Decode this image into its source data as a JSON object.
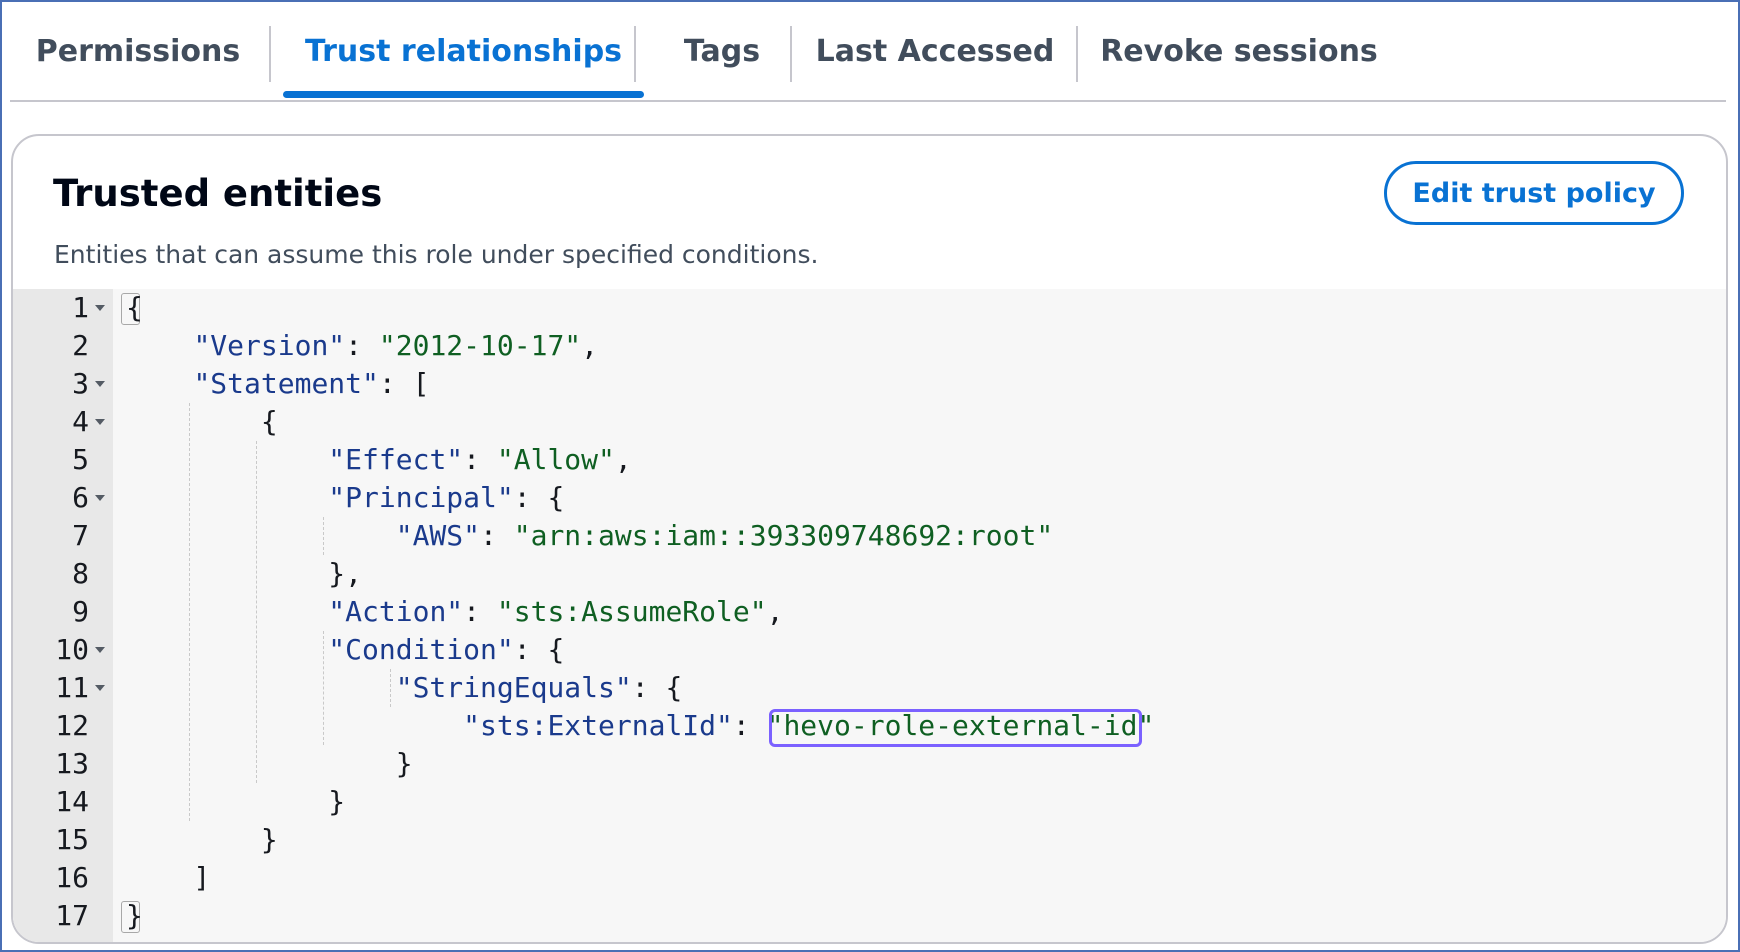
{
  "tabs": [
    {
      "label": "Permissions",
      "active": false
    },
    {
      "label": "Trust relationships",
      "active": true
    },
    {
      "label": "Tags",
      "active": false
    },
    {
      "label": "Last Accessed",
      "active": false
    },
    {
      "label": "Revoke sessions",
      "active": false
    }
  ],
  "panel": {
    "title": "Trusted entities",
    "description": "Entities that can assume this role under specified conditions.",
    "edit_button": "Edit trust policy"
  },
  "editor": {
    "lines": [
      {
        "n": "1",
        "fold": true,
        "t": [
          [
            "p",
            "{"
          ]
        ]
      },
      {
        "n": "2",
        "fold": false,
        "t": [
          [
            "p",
            "    "
          ],
          [
            "k",
            "\"Version\""
          ],
          [
            "p",
            ": "
          ],
          [
            "s",
            "\"2012-10-17\""
          ],
          [
            "p",
            ","
          ]
        ]
      },
      {
        "n": "3",
        "fold": true,
        "t": [
          [
            "p",
            "    "
          ],
          [
            "k",
            "\"Statement\""
          ],
          [
            "p",
            ": ["
          ]
        ]
      },
      {
        "n": "4",
        "fold": true,
        "t": [
          [
            "p",
            "        {"
          ]
        ]
      },
      {
        "n": "5",
        "fold": false,
        "t": [
          [
            "p",
            "            "
          ],
          [
            "k",
            "\"Effect\""
          ],
          [
            "p",
            ": "
          ],
          [
            "s",
            "\"Allow\""
          ],
          [
            "p",
            ","
          ]
        ]
      },
      {
        "n": "6",
        "fold": true,
        "t": [
          [
            "p",
            "            "
          ],
          [
            "k",
            "\"Principal\""
          ],
          [
            "p",
            ": {"
          ]
        ]
      },
      {
        "n": "7",
        "fold": false,
        "t": [
          [
            "p",
            "                "
          ],
          [
            "k",
            "\"AWS\""
          ],
          [
            "p",
            ": "
          ],
          [
            "s",
            "\"arn:aws:iam::393309748692:root\""
          ]
        ]
      },
      {
        "n": "8",
        "fold": false,
        "t": [
          [
            "p",
            "            },"
          ]
        ]
      },
      {
        "n": "9",
        "fold": false,
        "t": [
          [
            "p",
            "            "
          ],
          [
            "k",
            "\"Action\""
          ],
          [
            "p",
            ": "
          ],
          [
            "s",
            "\"sts:AssumeRole\""
          ],
          [
            "p",
            ","
          ]
        ]
      },
      {
        "n": "10",
        "fold": true,
        "t": [
          [
            "p",
            "            "
          ],
          [
            "k",
            "\"Condition\""
          ],
          [
            "p",
            ": {"
          ]
        ]
      },
      {
        "n": "11",
        "fold": true,
        "t": [
          [
            "p",
            "                "
          ],
          [
            "k",
            "\"StringEquals\""
          ],
          [
            "p",
            ": {"
          ]
        ]
      },
      {
        "n": "12",
        "fold": false,
        "t": [
          [
            "p",
            "                    "
          ],
          [
            "k",
            "\"sts:ExternalId\""
          ],
          [
            "p",
            ": "
          ],
          [
            "s",
            "\"hevo-role-external-id\""
          ]
        ]
      },
      {
        "n": "13",
        "fold": false,
        "t": [
          [
            "p",
            "                }"
          ]
        ]
      },
      {
        "n": "14",
        "fold": false,
        "t": [
          [
            "p",
            "            }"
          ]
        ]
      },
      {
        "n": "15",
        "fold": false,
        "t": [
          [
            "p",
            "        }"
          ]
        ]
      },
      {
        "n": "16",
        "fold": false,
        "t": [
          [
            "p",
            "    ]"
          ]
        ]
      },
      {
        "n": "17",
        "fold": false,
        "t": [
          [
            "p",
            "}"
          ]
        ]
      }
    ]
  }
}
